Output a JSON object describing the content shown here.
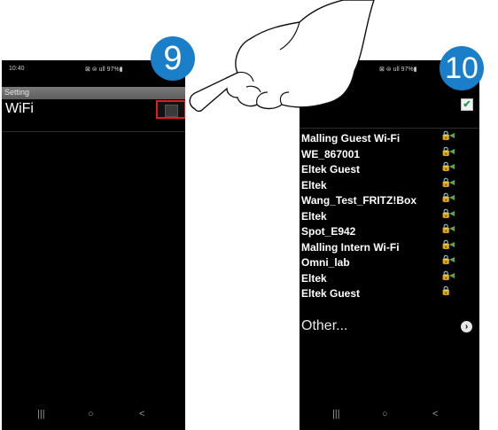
{
  "left_screen": {
    "status_time": "10:40",
    "status_icons": "⊠ ⊜ ull 97%▮",
    "settings_title": "Setting",
    "wifi_label": "WiFi",
    "nav_icons": [
      "|||",
      "○",
      "<"
    ]
  },
  "right_screen": {
    "status_icons": "⊠ ⊜ ull 97%▮",
    "networks": [
      {
        "ssid": "Malling Guest Wi-Fi",
        "lock": "🔒",
        "signal": "◀"
      },
      {
        "ssid": "WE_867001",
        "lock": "🔒",
        "signal": "◀"
      },
      {
        "ssid": "Eltek Guest",
        "lock": "🔒",
        "signal": "◀"
      },
      {
        "ssid": "Eltek",
        "lock": "🔒",
        "signal": "◀"
      },
      {
        "ssid": "Wang_Test_FRITZ!Box",
        "lock": "🔒",
        "signal": "◀"
      },
      {
        "ssid": "Eltek",
        "lock": "🔒",
        "signal": "◀"
      },
      {
        "ssid": "Spot_E942",
        "lock": "🔒",
        "signal": "◀"
      },
      {
        "ssid": "Malling Intern Wi-Fi",
        "lock": "🔒",
        "signal": "◀"
      },
      {
        "ssid": "Omni_lab",
        "lock": "🔒",
        "signal": "◀"
      },
      {
        "ssid": "Eltek",
        "lock": "🔒",
        "signal": "◀"
      },
      {
        "ssid": "Eltek Guest",
        "lock": "🔒",
        "signal": ""
      }
    ],
    "other_label": "Other...",
    "checkbox_mark": "✔",
    "more_icon": "›",
    "nav_icons": [
      "|||",
      "○",
      "<"
    ]
  },
  "badges": {
    "step_9": "9",
    "step_10": "10"
  },
  "icons": {
    "checkbox": "check-icon",
    "lock": "lock-icon",
    "signal": "wifi-signal-icon",
    "more": "chevron-right-icon"
  },
  "colors": {
    "badge_blue": "#1a7ec8",
    "highlight_red": "#e11b22",
    "signal_green": "#5fa84a"
  }
}
